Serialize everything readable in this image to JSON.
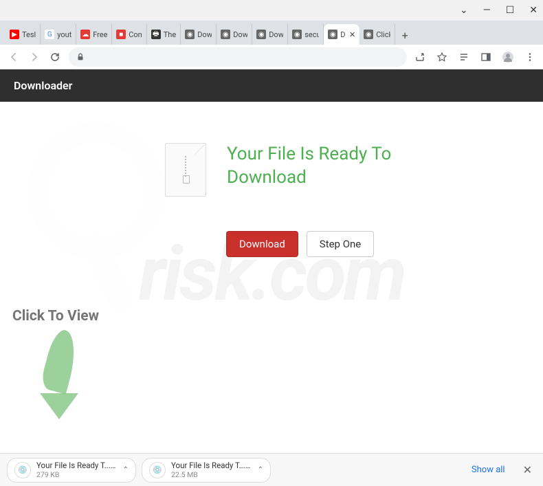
{
  "window": {
    "minimize": "—",
    "maximize": "☐",
    "close": "✕",
    "dropdown": "⌄"
  },
  "tabs": [
    {
      "title": "Tesl",
      "favicon_bg": "#ff0000",
      "glyph": "▶",
      "glyph_color": "#fff"
    },
    {
      "title": "yout",
      "favicon_bg": "#fff",
      "glyph": "G",
      "glyph_color": "#4285f4"
    },
    {
      "title": "Free",
      "favicon_bg": "#e53935",
      "glyph": "☁",
      "glyph_color": "#fff"
    },
    {
      "title": "Con",
      "favicon_bg": "#e53935",
      "glyph": "■",
      "glyph_color": "#fff"
    },
    {
      "title": "The",
      "favicon_bg": "#333",
      "glyph": "🖶",
      "glyph_color": "#fff"
    },
    {
      "title": "Dow",
      "favicon_bg": "#666",
      "glyph": "◉",
      "glyph_color": "#fff"
    },
    {
      "title": "Dow",
      "favicon_bg": "#666",
      "glyph": "◉",
      "glyph_color": "#fff"
    },
    {
      "title": "Dow",
      "favicon_bg": "#666",
      "glyph": "◉",
      "glyph_color": "#fff"
    },
    {
      "title": "secu",
      "favicon_bg": "#666",
      "glyph": "◉",
      "glyph_color": "#fff"
    },
    {
      "title": "D",
      "favicon_bg": "#666",
      "glyph": "◉",
      "glyph_color": "#fff",
      "active": true
    },
    {
      "title": "Click",
      "favicon_bg": "#666",
      "glyph": "◉",
      "glyph_color": "#fff"
    }
  ],
  "new_tab": "+",
  "page": {
    "header": "Downloader",
    "headline": "Your File Is Ready To Download",
    "download_btn": "Download",
    "step_btn": "Step One",
    "cta": "Click To View",
    "watermark": "risk.com"
  },
  "downloads": {
    "items": [
      {
        "name": "Your File Is Ready T....iso",
        "size": "279 KB"
      },
      {
        "name": "Your File Is Ready T....iso",
        "size": "22.5 MB"
      }
    ],
    "show_all": "Show all"
  }
}
